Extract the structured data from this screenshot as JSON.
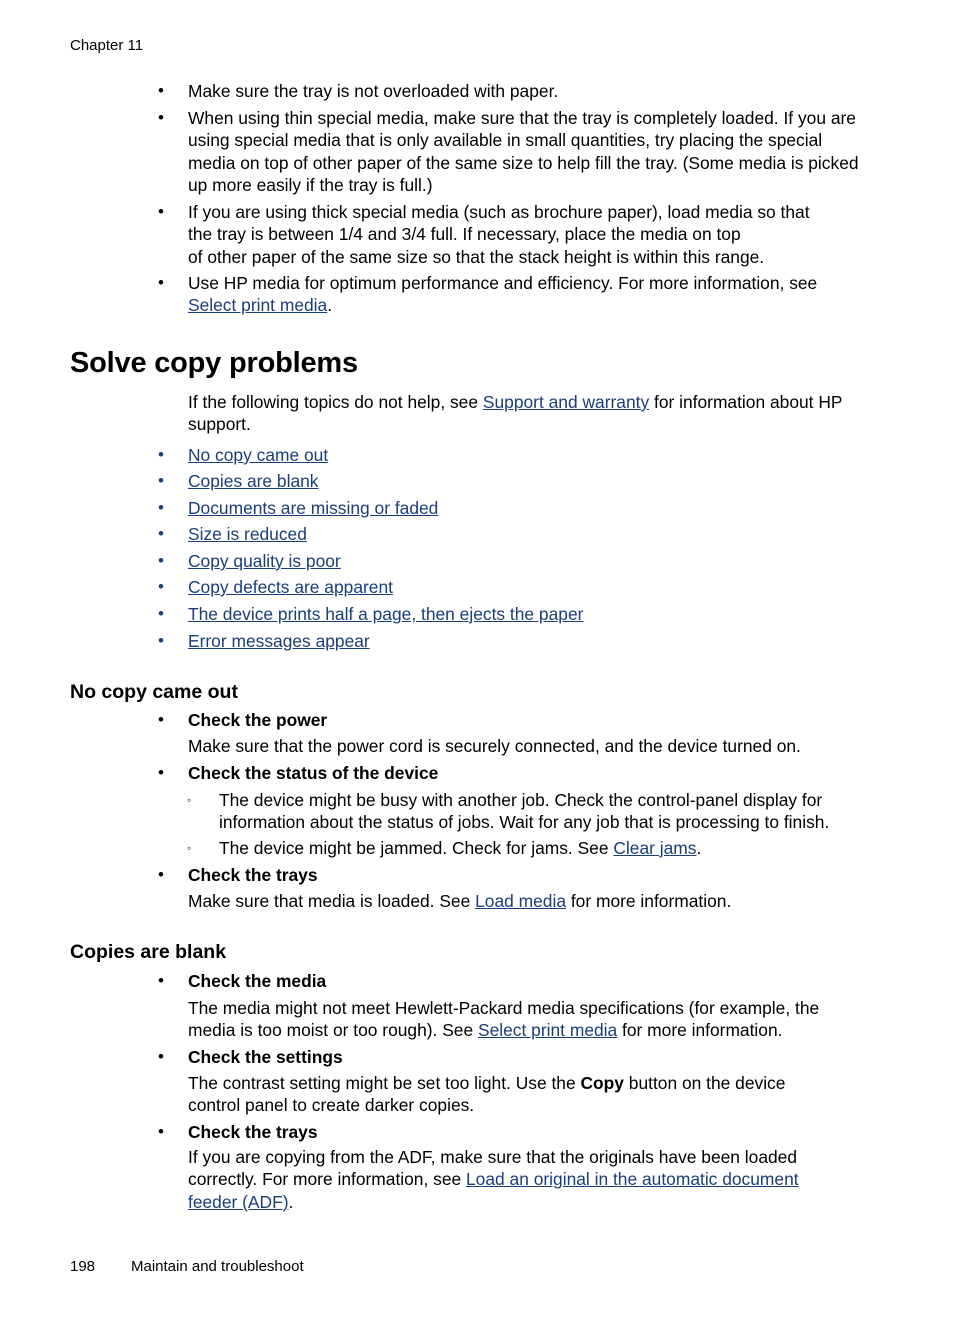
{
  "header": {
    "chapter": "Chapter 11"
  },
  "intro_bullets": [
    {
      "text": "Make sure the tray is not overloaded with paper."
    },
    {
      "text": "When using thin special media, make sure that the tray is completely loaded. If you are using special media that is only available in small quantities, try placing the special media on top of other paper of the same size to help fill the tray. (Some media is picked up more easily if the tray is full.)"
    },
    {
      "line1": "If you are using thick special media (such as brochure paper), load media so that",
      "line2": "the tray is between 1/4 and 3/4 full. If necessary, place the media on top",
      "line3": "of other paper of the same size so that the stack height is within this range."
    },
    {
      "pre": "Use HP media for optimum performance and efficiency. For more information, see ",
      "link": "Select print media",
      "post": "."
    }
  ],
  "section": {
    "title": "Solve copy problems",
    "intro_pre": "If the following topics do not help, see ",
    "intro_link": "Support and warranty",
    "intro_post": " for information about HP support.",
    "topics": [
      "No copy came out",
      "Copies are blank",
      "Documents are missing or faded",
      "Size is reduced",
      "Copy quality is poor",
      "Copy defects are apparent",
      "The device prints half a page, then ejects the paper",
      "Error messages appear"
    ]
  },
  "no_copy": {
    "title": "No copy came out",
    "power_title": "Check the power",
    "power_text": "Make sure that the power cord is securely connected, and the device turned on.",
    "status_title": "Check the status of the device",
    "status_sub1": "The device might be busy with another job. Check the control-panel display for information about the status of jobs. Wait for any job that is processing to finish.",
    "status_sub2_pre": "The device might be jammed. Check for jams. See ",
    "status_sub2_link": "Clear jams",
    "status_sub2_post": ".",
    "trays_title": "Check the trays",
    "trays_pre": "Make sure that media is loaded. See ",
    "trays_link": "Load media",
    "trays_post": " for more information."
  },
  "blank": {
    "title": "Copies are blank",
    "media_title": "Check the media",
    "media_pre": "The media might not meet Hewlett-Packard media specifications (for example, the media is too moist or too rough). See ",
    "media_link": "Select print media",
    "media_post": " for more information.",
    "settings_title": "Check the settings",
    "settings_pre": "The contrast setting might be set too light. Use the ",
    "settings_bold": "Copy",
    "settings_post": " button on the device control panel to create darker copies.",
    "trays_title": "Check the trays",
    "trays_pre": "If you are copying from the ADF, make sure that the originals have been loaded correctly. For more information, see ",
    "trays_link": "Load an original in the automatic document feeder (ADF)",
    "trays_post": "."
  },
  "footer": {
    "page_number": "198",
    "section": "Maintain and troubleshoot"
  },
  "bullet_glyph": "•",
  "sub_bullet_glyph": "◦"
}
